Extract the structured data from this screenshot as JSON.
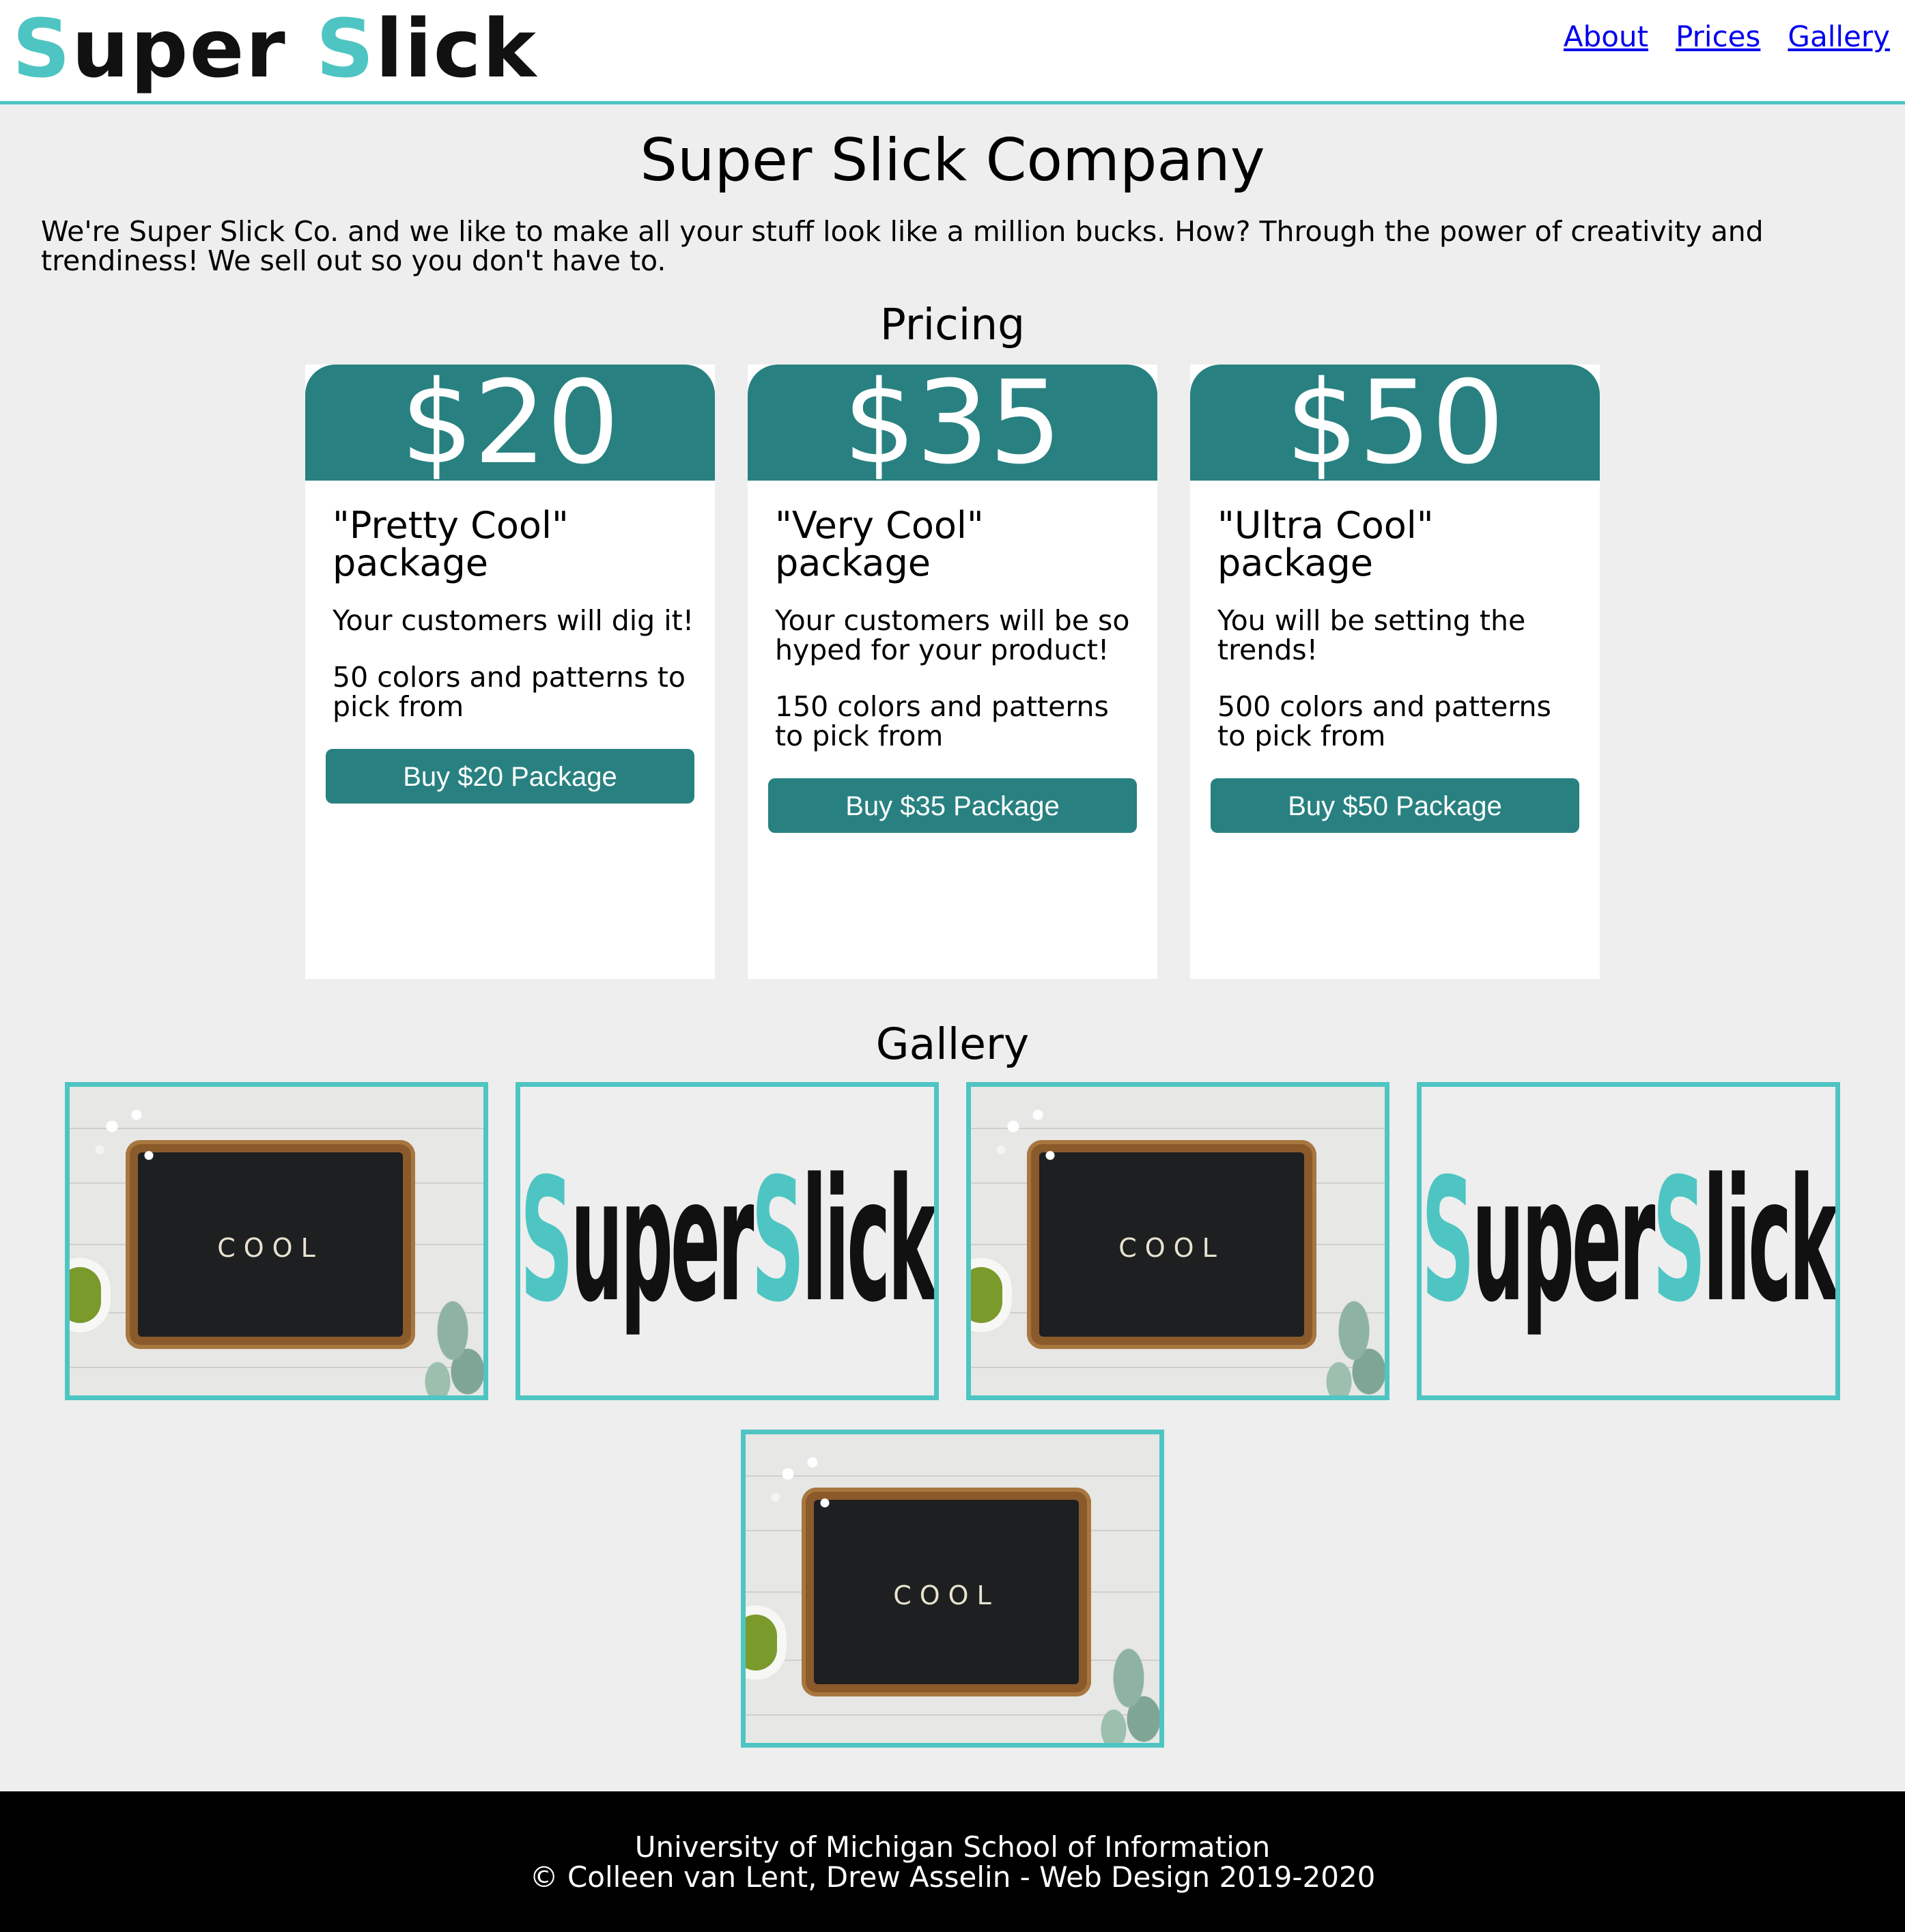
{
  "header": {
    "logo_part1": "S",
    "logo_part2": "uper ",
    "logo_part3": "S",
    "logo_part4": "lick",
    "nav": [
      "About",
      "Prices",
      "Gallery"
    ]
  },
  "main": {
    "title": "Super Slick Company",
    "intro": "We're Super Slick Co. and we like to make all your stuff look like a million bucks. How? Through the power of creativity and trendiness! We sell out so you don't have to.",
    "pricing_heading": "Pricing",
    "gallery_heading": "Gallery"
  },
  "cards": [
    {
      "price": "$20",
      "name": "\"Pretty Cool\" package",
      "desc": "Your customers will dig it!",
      "colors": "50 colors and patterns to pick from",
      "button": "Buy $20 Package"
    },
    {
      "price": "$35",
      "name": "\"Very Cool\" package",
      "desc": "Your customers will be so hyped for your product!",
      "colors": "150 colors and patterns to pick from",
      "button": "Buy $35 Package"
    },
    {
      "price": "$50",
      "name": "\"Ultra Cool\" package",
      "desc": "You will be setting the trends!",
      "colors": "500 colors and patterns to pick from",
      "button": "Buy $50 Package"
    }
  ],
  "gallery": {
    "board_word": "COOL",
    "logo_part1": "S",
    "logo_part2": "uper ",
    "logo_part3": "S",
    "logo_part4": "lick"
  },
  "footer": {
    "line1": "University of Michigan School of Information",
    "line2": "© Colleen van Lent, Drew Asselin - Web Design 2019-2020"
  },
  "colors": {
    "accent": "#4ec5c3",
    "teal": "#288180",
    "link": "#0000ee",
    "background": "#eeeeee"
  }
}
